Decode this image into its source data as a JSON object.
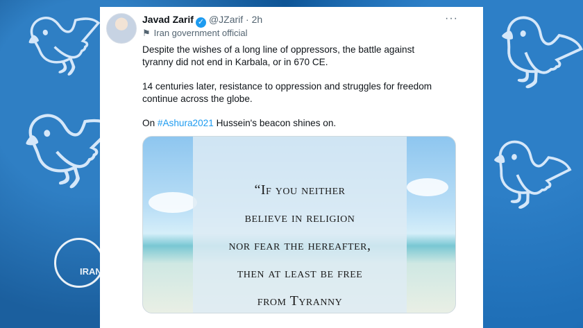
{
  "background": {
    "watermark_text": "IRAN",
    "accent_color": "#1d9bf0"
  },
  "tweet": {
    "author_name": "Javad Zarif",
    "handle": "@JZarif",
    "separator": "·",
    "time": "2h",
    "label": "Iran government official",
    "paragraphs": [
      "Despite the wishes of a long line of oppressors, the battle against tyranny did not end in Karbala, or in 670 CE.",
      "14 centuries later, resistance to oppression and struggles for freedom continue across the globe."
    ],
    "last_prefix": "On ",
    "hashtag": "#Ashura2021",
    "last_suffix": " Hussein's beacon shines on.",
    "more_label": "···",
    "image_quote": [
      "“If you neither",
      "believe in religion",
      "nor fear the hereafter,",
      "then at least be free",
      "from Tyranny"
    ]
  }
}
